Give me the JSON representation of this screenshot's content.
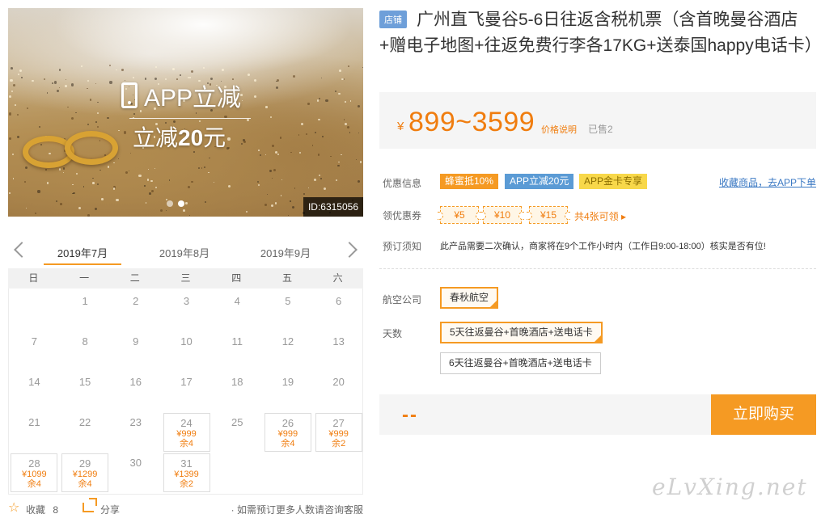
{
  "gallery": {
    "promo_title": "APP立减",
    "promo_prefix": "立减",
    "promo_amount": "20",
    "promo_suffix": "元",
    "image_id": "ID:6315056",
    "slide_count": 2,
    "active_slide": 2
  },
  "calendar": {
    "months": [
      "2019年7月",
      "2019年8月",
      "2019年9月"
    ],
    "active_month": "2019年7月",
    "weekdays": [
      "日",
      "一",
      "二",
      "三",
      "四",
      "五",
      "六"
    ],
    "days": [
      {
        "day": "1",
        "col": 1,
        "row": 0
      },
      {
        "day": "2",
        "col": 2,
        "row": 0
      },
      {
        "day": "3",
        "col": 3,
        "row": 0
      },
      {
        "day": "4",
        "col": 4,
        "row": 0
      },
      {
        "day": "5",
        "col": 5,
        "row": 0
      },
      {
        "day": "6",
        "col": 6,
        "row": 0
      },
      {
        "day": "7",
        "col": 0,
        "row": 1
      },
      {
        "day": "8",
        "col": 1,
        "row": 1
      },
      {
        "day": "9",
        "col": 2,
        "row": 1
      },
      {
        "day": "10",
        "col": 3,
        "row": 1
      },
      {
        "day": "11",
        "col": 4,
        "row": 1
      },
      {
        "day": "12",
        "col": 5,
        "row": 1
      },
      {
        "day": "13",
        "col": 6,
        "row": 1
      },
      {
        "day": "14",
        "col": 0,
        "row": 2
      },
      {
        "day": "15",
        "col": 1,
        "row": 2
      },
      {
        "day": "16",
        "col": 2,
        "row": 2
      },
      {
        "day": "17",
        "col": 3,
        "row": 2
      },
      {
        "day": "18",
        "col": 4,
        "row": 2
      },
      {
        "day": "19",
        "col": 5,
        "row": 2
      },
      {
        "day": "20",
        "col": 6,
        "row": 2
      },
      {
        "day": "21",
        "col": 0,
        "row": 3
      },
      {
        "day": "22",
        "col": 1,
        "row": 3
      },
      {
        "day": "23",
        "col": 2,
        "row": 3
      },
      {
        "day": "24",
        "col": 3,
        "row": 3,
        "price": "¥999",
        "left": "余4"
      },
      {
        "day": "25",
        "col": 4,
        "row": 3
      },
      {
        "day": "26",
        "col": 5,
        "row": 3,
        "price": "¥999",
        "left": "余4"
      },
      {
        "day": "27",
        "col": 6,
        "row": 3,
        "price": "¥999",
        "left": "余2"
      },
      {
        "day": "28",
        "col": 0,
        "row": 4,
        "price": "¥1099",
        "left": "余4"
      },
      {
        "day": "29",
        "col": 1,
        "row": 4,
        "price": "¥1299",
        "left": "余4"
      },
      {
        "day": "30",
        "col": 2,
        "row": 4
      },
      {
        "day": "31",
        "col": 3,
        "row": 4,
        "price": "¥1399",
        "left": "余2"
      }
    ],
    "footer": {
      "favorite_label": "收藏",
      "favorite_count": "8",
      "share_label": "分享",
      "consult_text": "· 如需预订更多人数请咨询客服"
    }
  },
  "product": {
    "shop_badge": "店铺",
    "title": "广州直飞曼谷5-6日往返含税机票（含首晚曼谷酒店+赠电子地图+往返免费行李各17KG+送泰国happy电话卡）",
    "price_currency": "¥",
    "price_range": "899~3599",
    "price_note": "价格说明",
    "sold_text": "已售2"
  },
  "offers": {
    "label": "优惠信息",
    "tags": [
      {
        "text": "蜂蜜抵10%",
        "color": "#f59a23",
        "textColor": "#ffffff"
      },
      {
        "text": "APP立减20元",
        "color": "#5b9bd5",
        "textColor": "#ffffff"
      },
      {
        "text": "APP金卡专享",
        "color": "#f8d84a",
        "textColor": "#8a6d00"
      }
    ],
    "app_link": "收藏商品，去APP下单"
  },
  "coupons": {
    "label": "领优惠券",
    "items": [
      "¥5",
      "¥10",
      "¥15"
    ],
    "more": "共4张可领 ▸"
  },
  "notice": {
    "label": "预订须知",
    "text": "此产品需要二次确认，商家将在9个工作小时内（工作日9:00-18:00）核实是否有位!"
  },
  "options": {
    "airline_label": "航空公司",
    "airline": "春秋航空",
    "days_label": "天数",
    "day_options": [
      "5天往返曼谷+首晚酒店+送电话卡",
      "6天往返曼谷+首晚酒店+送电话卡"
    ],
    "selected_day_option": 0
  },
  "purchase": {
    "total": "--",
    "buy_label": "立即购买"
  },
  "watermark": "eLvXing.net",
  "colors": {
    "accent": "#f59a23",
    "price": "#f07d0f",
    "link": "#3a78c3",
    "badge": "#6e9fd9"
  }
}
